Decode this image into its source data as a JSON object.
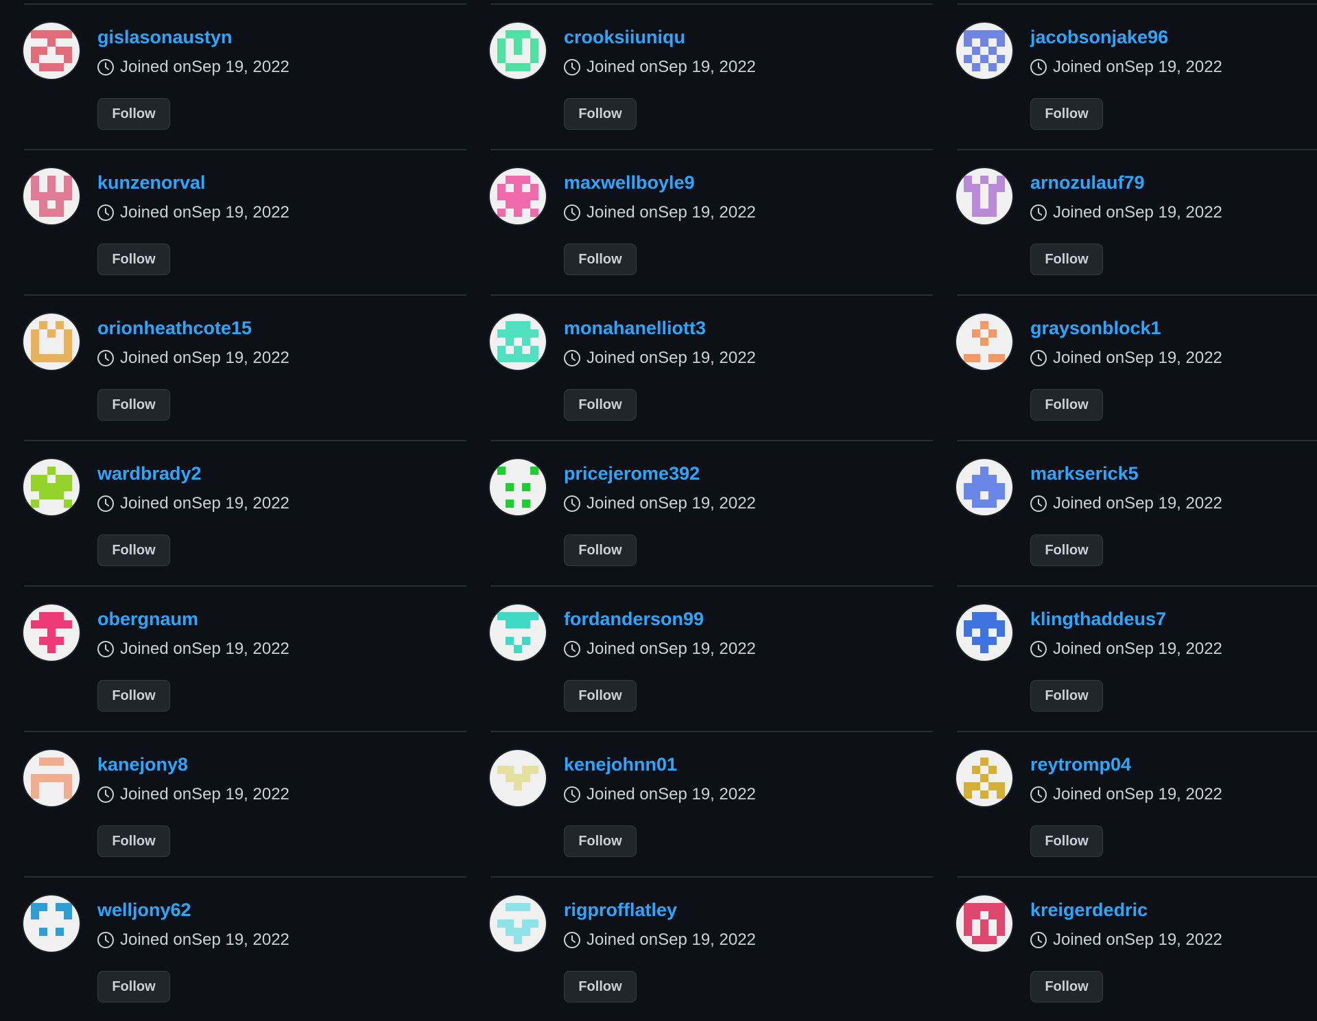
{
  "follow_label": "Follow",
  "joined_prefix": "Joined on",
  "users": [
    {
      "username": "gislasonaustyn",
      "joined": "Sep 19, 2022",
      "avatar_color": "#e26d7a",
      "pattern": [
        "11111",
        "00100",
        "11011",
        "10001",
        "01110"
      ]
    },
    {
      "username": "crooksiiuniqu",
      "joined": "Sep 19, 2022",
      "avatar_color": "#4fe0a4",
      "pattern": [
        "01110",
        "10101",
        "10101",
        "10001",
        "01110"
      ]
    },
    {
      "username": "jacobsonjake96",
      "joined": "Sep 19, 2022",
      "avatar_color": "#6f86e0",
      "pattern": [
        "11111",
        "10101",
        "01010",
        "10101",
        "01010"
      ]
    },
    {
      "username": "kunzenorval",
      "joined": "Sep 19, 2022",
      "avatar_color": "#e07a95",
      "pattern": [
        "10101",
        "10101",
        "11111",
        "01010",
        "01110"
      ]
    },
    {
      "username": "maxwellboyle9",
      "joined": "Sep 19, 2022",
      "avatar_color": "#ef6aaa",
      "pattern": [
        "01110",
        "10101",
        "11111",
        "01110",
        "10101"
      ]
    },
    {
      "username": "arnozulauf79",
      "joined": "Sep 19, 2022",
      "avatar_color": "#b98ad8",
      "pattern": [
        "10101",
        "11011",
        "01010",
        "01010",
        "01110"
      ]
    },
    {
      "username": "orionheathcote15",
      "joined": "Sep 19, 2022",
      "avatar_color": "#e6b25c",
      "pattern": [
        "01010",
        "10101",
        "10001",
        "10001",
        "11111"
      ]
    },
    {
      "username": "monahanelliott3",
      "joined": "Sep 19, 2022",
      "avatar_color": "#4fe0c0",
      "pattern": [
        "01110",
        "11111",
        "01010",
        "10101",
        "11111"
      ]
    },
    {
      "username": "graysonblock1",
      "joined": "Sep 19, 2022",
      "avatar_color": "#f09a6a",
      "pattern": [
        "00100",
        "01010",
        "00100",
        "00000",
        "11011"
      ]
    },
    {
      "username": "wardbrady2",
      "joined": "Sep 19, 2022",
      "avatar_color": "#94d42a",
      "pattern": [
        "00100",
        "11011",
        "11111",
        "01110",
        "10001"
      ]
    },
    {
      "username": "pricejerome392",
      "joined": "Sep 19, 2022",
      "avatar_color": "#22cc33",
      "pattern": [
        "10001",
        "00000",
        "01010",
        "00000",
        "01010"
      ]
    },
    {
      "username": "markserick5",
      "joined": "Sep 19, 2022",
      "avatar_color": "#6a86e6",
      "pattern": [
        "00100",
        "01110",
        "11111",
        "11011",
        "01110"
      ]
    },
    {
      "username": "obergnaum",
      "joined": "Sep 19, 2022",
      "avatar_color": "#ef3a78",
      "pattern": [
        "01110",
        "11111",
        "00100",
        "01110",
        "00100"
      ]
    },
    {
      "username": "fordanderson99",
      "joined": "Sep 19, 2022",
      "avatar_color": "#3fd9c4",
      "pattern": [
        "11111",
        "01110",
        "00000",
        "01010",
        "00100"
      ]
    },
    {
      "username": "klingthaddeus7",
      "joined": "Sep 19, 2022",
      "avatar_color": "#3f74e0",
      "pattern": [
        "01110",
        "11111",
        "10101",
        "01110",
        "00100"
      ]
    },
    {
      "username": "kanejony8",
      "joined": "Sep 19, 2022",
      "avatar_color": "#f0ad90",
      "pattern": [
        "01110",
        "00000",
        "11111",
        "10001",
        "10001"
      ]
    },
    {
      "username": "kenejohnn01",
      "joined": "Sep 19, 2022",
      "avatar_color": "#e6e0a0",
      "pattern": [
        "00000",
        "11011",
        "01110",
        "00100",
        "00000"
      ]
    },
    {
      "username": "reytromp04",
      "joined": "Sep 19, 2022",
      "avatar_color": "#d4b036",
      "pattern": [
        "00100",
        "01010",
        "00100",
        "11011",
        "10101"
      ]
    },
    {
      "username": "welljony62",
      "joined": "Sep 19, 2022",
      "avatar_color": "#2d9fd2",
      "pattern": [
        "11011",
        "10001",
        "00000",
        "01010",
        "00000"
      ]
    },
    {
      "username": "rigprofflatley",
      "joined": "Sep 19, 2022",
      "avatar_color": "#8fe3e8",
      "pattern": [
        "01110",
        "00000",
        "11011",
        "01110",
        "00100"
      ]
    },
    {
      "username": "kreigerdedric",
      "joined": "Sep 19, 2022",
      "avatar_color": "#e0466e",
      "pattern": [
        "11111",
        "11011",
        "10101",
        "10101",
        "01110"
      ]
    }
  ]
}
